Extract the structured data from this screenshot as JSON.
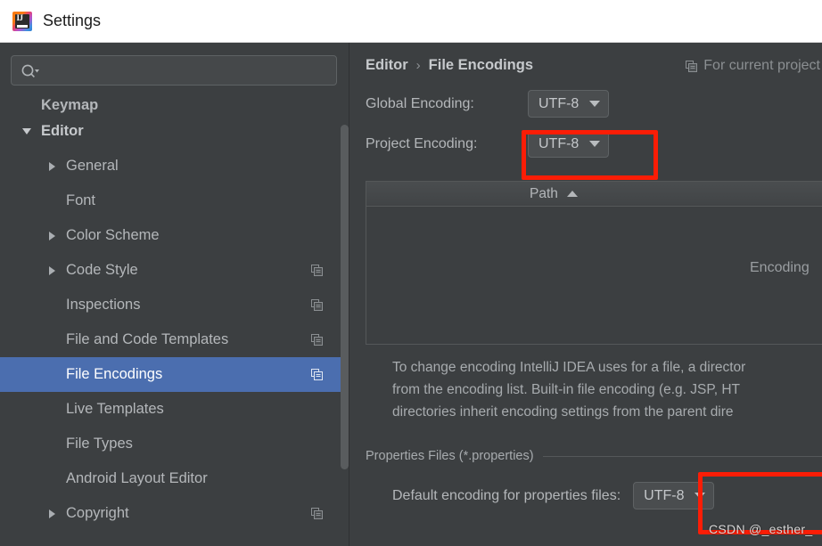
{
  "window": {
    "title": "Settings",
    "logo_icon": "intellij-idea-logo"
  },
  "sidebar": {
    "search": {
      "value": "",
      "placeholder": "",
      "icon": "search-icon"
    },
    "items": [
      {
        "label": "Keymap",
        "indent": 0,
        "twisty": "none",
        "badge": false,
        "selected": false,
        "bold": true,
        "clipped": true
      },
      {
        "label": "Editor",
        "indent": 0,
        "twisty": "down",
        "badge": false,
        "selected": false,
        "bold": true,
        "clipped": false
      },
      {
        "label": "General",
        "indent": 1,
        "twisty": "right",
        "badge": false,
        "selected": false,
        "bold": false,
        "clipped": false
      },
      {
        "label": "Font",
        "indent": 1,
        "twisty": "none",
        "badge": false,
        "selected": false,
        "bold": false,
        "clipped": false
      },
      {
        "label": "Color Scheme",
        "indent": 1,
        "twisty": "right",
        "badge": false,
        "selected": false,
        "bold": false,
        "clipped": false
      },
      {
        "label": "Code Style",
        "indent": 1,
        "twisty": "right",
        "badge": true,
        "selected": false,
        "bold": false,
        "clipped": false
      },
      {
        "label": "Inspections",
        "indent": 1,
        "twisty": "none",
        "badge": true,
        "selected": false,
        "bold": false,
        "clipped": false
      },
      {
        "label": "File and Code Templates",
        "indent": 1,
        "twisty": "none",
        "badge": true,
        "selected": false,
        "bold": false,
        "clipped": false
      },
      {
        "label": "File Encodings",
        "indent": 1,
        "twisty": "none",
        "badge": true,
        "selected": true,
        "bold": false,
        "clipped": false
      },
      {
        "label": "Live Templates",
        "indent": 1,
        "twisty": "none",
        "badge": false,
        "selected": false,
        "bold": false,
        "clipped": false
      },
      {
        "label": "File Types",
        "indent": 1,
        "twisty": "none",
        "badge": false,
        "selected": false,
        "bold": false,
        "clipped": false
      },
      {
        "label": "Android Layout Editor",
        "indent": 1,
        "twisty": "none",
        "badge": false,
        "selected": false,
        "bold": false,
        "clipped": false
      },
      {
        "label": "Copyright",
        "indent": 1,
        "twisty": "right",
        "badge": true,
        "selected": false,
        "bold": false,
        "clipped": false
      }
    ]
  },
  "main": {
    "breadcrumb": {
      "parent": "Editor",
      "separator": "›",
      "current": "File Encodings"
    },
    "for_current_project": {
      "label": "For current project",
      "icon": "project-scope-icon"
    },
    "global_encoding": {
      "label": "Global Encoding:",
      "value": "UTF-8"
    },
    "project_encoding": {
      "label": "Project Encoding:",
      "value": "UTF-8"
    },
    "table": {
      "col_path": "Path",
      "col_encoding": "Encoding",
      "sort_icon": "sort-ascending-icon",
      "rows": []
    },
    "help_text_lines": [
      "To change encoding IntelliJ IDEA uses for a file, a director",
      "from the encoding list. Built-in file encoding (e.g. JSP, HT",
      "directories inherit encoding settings from the parent dire"
    ],
    "properties_section": {
      "caption": "Properties Files (*.properties)",
      "default_encoding_label": "Default encoding for properties files:",
      "default_encoding_value": "UTF-8"
    }
  },
  "annotations": {
    "highlight_color": "#fb1d06",
    "watermark": "CSDN @_esther_"
  },
  "colors": {
    "panel_bg": "#3c3f41",
    "titlebar_bg": "#ffffff",
    "selection_blue": "#4b6eaf",
    "text_primary": "#b4b7ba"
  }
}
